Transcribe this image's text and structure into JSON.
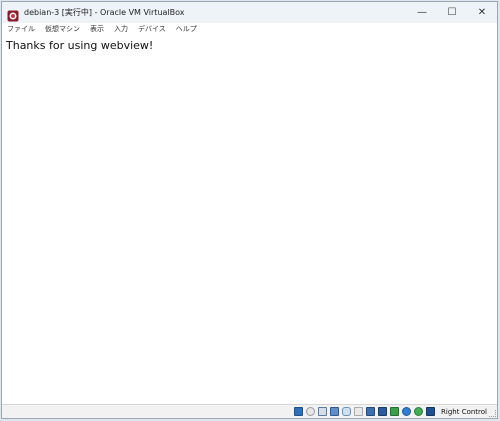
{
  "window": {
    "title": "debian-3 [実行中] - Oracle VM VirtualBox",
    "controls": {
      "minimize": "—",
      "maximize": "☐",
      "close": "✕"
    }
  },
  "menubar": {
    "items": [
      "ファイル",
      "仮想マシン",
      "表示",
      "入力",
      "デバイス",
      "ヘルプ"
    ]
  },
  "content": {
    "message": "Thanks for using webview!"
  },
  "statusbar": {
    "host_key": "Right Control",
    "icons": [
      "hard-disk-icon",
      "optical-drive-icon",
      "audio-icon",
      "network-icon",
      "usb-icon",
      "shared-folders-icon",
      "display-icon",
      "video-capture-icon",
      "recording-icon",
      "guest-additions-icon",
      "mouse-integration-icon",
      "keyboard-capture-icon"
    ]
  },
  "colors": {
    "titlebar": "#eef3f8",
    "background": "#ffffff",
    "statusbar": "#f2f2f2"
  }
}
